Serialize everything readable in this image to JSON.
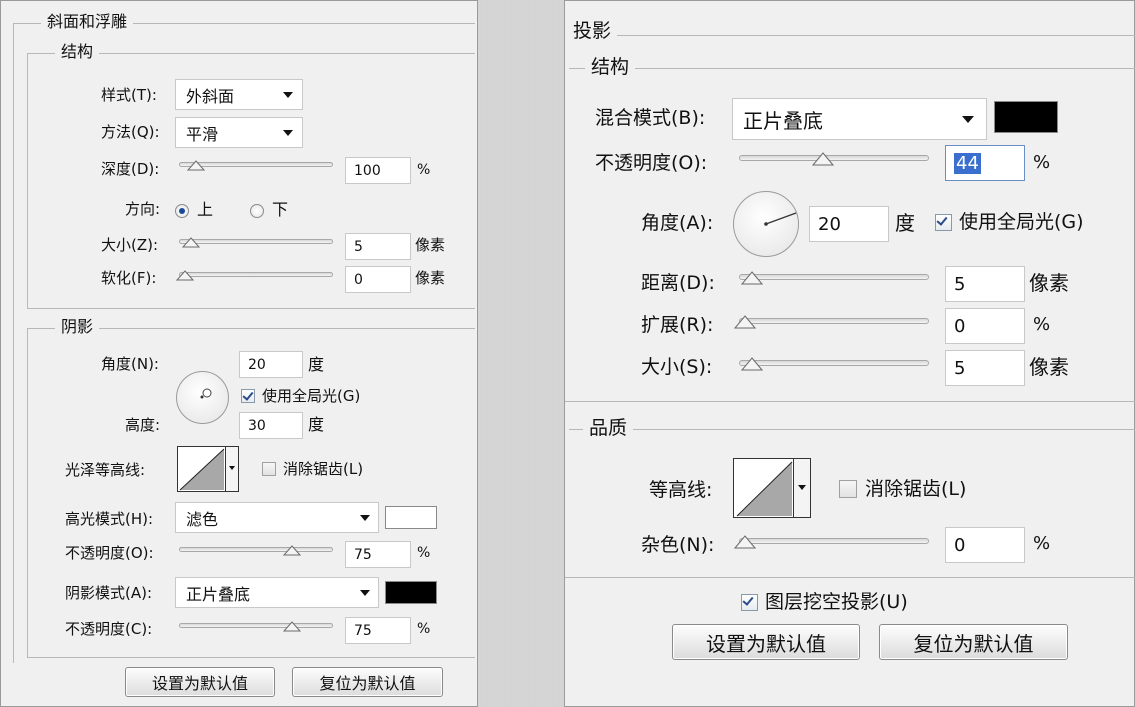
{
  "left": {
    "bevel": {
      "title": "斜面和浮雕",
      "structure": {
        "title": "结构",
        "style": {
          "label": "样式(T):",
          "value": "外斜面"
        },
        "technique": {
          "label": "方法(Q):",
          "value": "平滑"
        },
        "depth": {
          "label": "深度(D):",
          "value": "100",
          "unit": "%",
          "slider": 0.08
        },
        "direction": {
          "label": "方向:",
          "up": "上",
          "down": "下",
          "selected": "上"
        },
        "size": {
          "label": "大小(Z):",
          "value": "5",
          "unit": "像素",
          "slider": 0.04
        },
        "soften": {
          "label": "软化(F):",
          "value": "0",
          "unit": "像素",
          "slider": 0.0
        }
      },
      "shading": {
        "title": "阴影",
        "angle": {
          "label": "角度(N):",
          "value": "20",
          "unit": "度"
        },
        "global_light": {
          "label": "使用全局光(G)",
          "checked": true
        },
        "altitude": {
          "label": "高度:",
          "value": "30",
          "unit": "度"
        },
        "gloss_contour": {
          "label": "光泽等高线:"
        },
        "anti_aliased": {
          "label": "消除锯齿(L)",
          "checked": false
        },
        "highlight_mode": {
          "label": "高光模式(H):",
          "value": "滤色",
          "color": "#ffffff"
        },
        "highlight_opacity": {
          "label": "不透明度(O):",
          "value": "75",
          "unit": "%",
          "slider": 0.75
        },
        "shadow_mode": {
          "label": "阴影模式(A):",
          "value": "正片叠底",
          "color": "#000000"
        },
        "shadow_opacity": {
          "label": "不透明度(C):",
          "value": "75",
          "unit": "%",
          "slider": 0.75
        }
      },
      "buttons": {
        "make_default": "设置为默认值",
        "reset_default": "复位为默认值"
      }
    }
  },
  "right": {
    "drop_shadow": {
      "title": "投影",
      "structure": {
        "title": "结构",
        "blend_mode": {
          "label": "混合模式(B):",
          "value": "正片叠底",
          "color": "#000000"
        },
        "opacity": {
          "label": "不透明度(O):",
          "value": "44",
          "unit": "%",
          "slider": 0.44
        },
        "angle": {
          "label": "角度(A):",
          "value": "20",
          "unit": "度"
        },
        "global_light": {
          "label": "使用全局光(G)",
          "checked": true
        },
        "distance": {
          "label": "距离(D):",
          "value": "5",
          "unit": "像素",
          "slider": 0.04
        },
        "spread": {
          "label": "扩展(R):",
          "value": "0",
          "unit": "%",
          "slider": 0.0
        },
        "size": {
          "label": "大小(S):",
          "value": "5",
          "unit": "像素",
          "slider": 0.04
        }
      },
      "quality": {
        "title": "品质",
        "contour": {
          "label": "等高线:"
        },
        "anti_aliased": {
          "label": "消除锯齿(L)",
          "checked": false
        },
        "noise": {
          "label": "杂色(N):",
          "value": "0",
          "unit": "%",
          "slider": 0.0
        }
      },
      "knockout": {
        "label": "图层挖空投影(U)",
        "checked": true
      },
      "buttons": {
        "make_default": "设置为默认值",
        "reset_default": "复位为默认值"
      }
    }
  },
  "icons": [
    "chevron-down-icon",
    "slider-thumb-icon",
    "angle-dial-icon",
    "contour-preview-icon",
    "checkbox-icon",
    "radio-icon"
  ]
}
